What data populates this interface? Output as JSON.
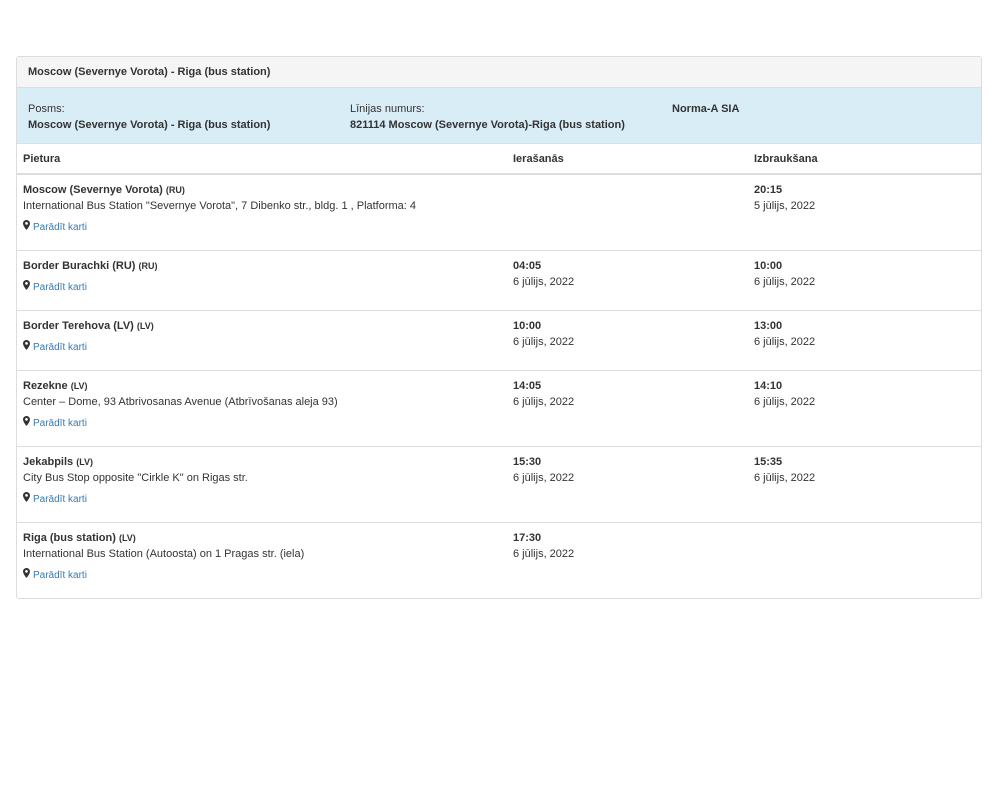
{
  "route": {
    "title": "Moscow (Severnye Vorota) - Riga (bus station)"
  },
  "info": {
    "posms_label": "Posms:",
    "posms_value": "Moscow (Severnye Vorota) - Riga (bus station)",
    "linija_label": "Līnijas numurs:",
    "linija_value": "821114 Moscow (Severnye Vorota)-Riga (bus station)",
    "carrier": "Norma-A SIA"
  },
  "table": {
    "headers": {
      "stop": "Pietura",
      "arrival": "Ierašanās",
      "departure": "Izbraukšana"
    },
    "map_link_label": "Parādīt karti",
    "rows": [
      {
        "name": "Moscow (Severnye Vorota)",
        "country": "(RU)",
        "address": "International Bus Station \"Severnye Vorota\", 7 Dibenko str., bldg. 1 , Platforma: 4",
        "arrival_time": "",
        "arrival_date": "",
        "departure_time": "20:15",
        "departure_date": "5 jūlijs, 2022"
      },
      {
        "name": "Border Burachki (RU)",
        "country": "(RU)",
        "address": "",
        "arrival_time": "04:05",
        "arrival_date": "6 jūlijs, 2022",
        "departure_time": "10:00",
        "departure_date": "6 jūlijs, 2022"
      },
      {
        "name": "Border Terehova (LV)",
        "country": "(LV)",
        "address": "",
        "arrival_time": "10:00",
        "arrival_date": "6 jūlijs, 2022",
        "departure_time": "13:00",
        "departure_date": "6 jūlijs, 2022"
      },
      {
        "name": "Rezekne",
        "country": "(LV)",
        "address": "Center – Dome, 93 Atbrivosanas Avenue (Atbrīvošanas aleja 93)",
        "arrival_time": "14:05",
        "arrival_date": "6 jūlijs, 2022",
        "departure_time": "14:10",
        "departure_date": "6 jūlijs, 2022"
      },
      {
        "name": "Jekabpils",
        "country": "(LV)",
        "address": "City Bus Stop opposite \"Cirkle K\" on Rigas str.",
        "arrival_time": "15:30",
        "arrival_date": "6 jūlijs, 2022",
        "departure_time": "15:35",
        "departure_date": "6 jūlijs, 2022"
      },
      {
        "name": "Riga (bus station)",
        "country": "(LV)",
        "address": "International Bus Station (Autoosta) on 1 Pragas str. (iela)",
        "arrival_time": "17:30",
        "arrival_date": "6 jūlijs, 2022",
        "departure_time": "",
        "departure_date": ""
      }
    ]
  }
}
